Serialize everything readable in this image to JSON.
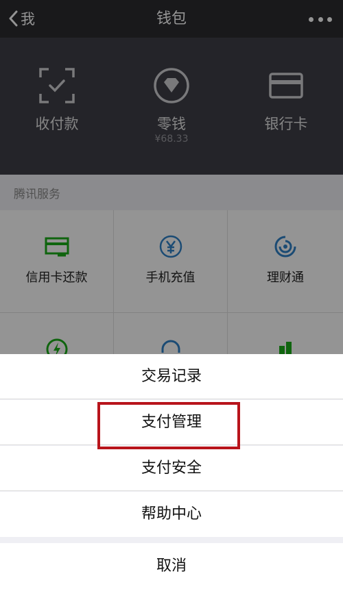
{
  "navbar": {
    "back_label": "我",
    "title": "钱包"
  },
  "wallet_header": [
    {
      "label": "收付款",
      "sub": ""
    },
    {
      "label": "零钱",
      "sub": "¥68.33"
    },
    {
      "label": "银行卡",
      "sub": ""
    }
  ],
  "section": {
    "label": "腾讯服务"
  },
  "services": [
    {
      "label": "信用卡还款"
    },
    {
      "label": "手机充值"
    },
    {
      "label": "理财通"
    }
  ],
  "action_sheet": {
    "items": [
      "交易记录",
      "支付管理",
      "支付安全",
      "帮助中心"
    ],
    "cancel": "取消"
  },
  "colors": {
    "navbar": "#2b2b30",
    "header": "#3e3f47",
    "service_green": "#1aad19",
    "service_blue": "#2f82c8",
    "highlight_red": "#b8141b"
  }
}
